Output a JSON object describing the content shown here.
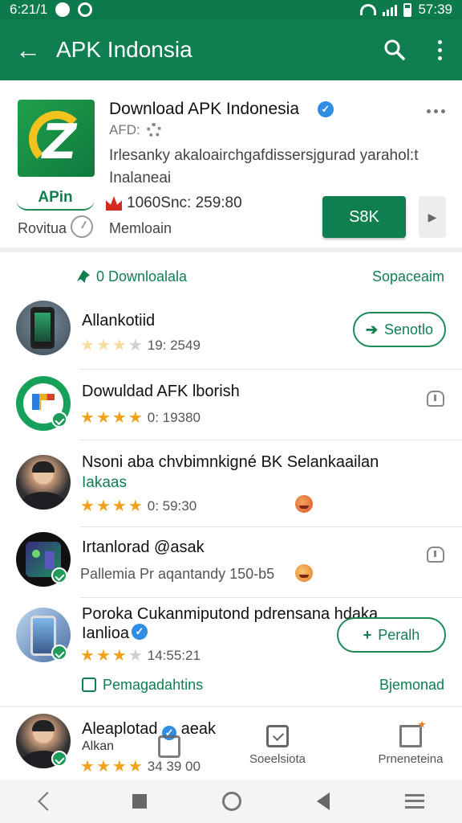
{
  "status": {
    "left_time": "6:21/1",
    "right_time": "57:39"
  },
  "appbar": {
    "title": "APK Indonsia"
  },
  "header": {
    "title": "Download APK Indonesia",
    "dev": "AFD:",
    "desc": "Irlesanky akaloairchgafdissersjgurad yarahol:t Inalaneai",
    "apk_label": "APin",
    "rovitua": "Rovitua",
    "stats": "1060Snc: 259:80",
    "memloain": "Memloain",
    "start_btn": "S8K",
    "next_icon": "chevron-right-icon"
  },
  "section1": {
    "left": "0 Downloalala",
    "right": "Sopaceaim"
  },
  "section2": {
    "left": "Pemagadahtins",
    "right": "Bjemonad"
  },
  "rows": [
    {
      "title": "Allankotiid",
      "meta": "19: 2549",
      "button": "Senotlo",
      "stars": 3
    },
    {
      "title": "Dowuldad AFK lborish",
      "meta": "0: 19380",
      "stars": 4
    },
    {
      "title": "Nsoni aba chvbimnkigné BK Selankaailan",
      "subtitle": "Iakaas",
      "meta": "0: 59:30",
      "stars": 4
    },
    {
      "title": "Irtanlorad @asak",
      "meta": "Pallemia  Pr aqantandy 150-b5"
    },
    {
      "title": "Poroka Cukanmiputond pdrensana hdaka Ianlioa",
      "meta": "14:55:21",
      "button": "Peralh",
      "stars": 3
    },
    {
      "title": "Aleaplotad",
      "title2": "aeak",
      "subtitle": "Alkan",
      "meta": "34 39 00",
      "stars": 5
    }
  ],
  "bottom_tabs": [
    {
      "label": "Soeelsiota"
    },
    {
      "label": "Prneneteina"
    }
  ],
  "nav": {
    "items": [
      "back-icon",
      "recent-icon",
      "home-icon",
      "back-triangle-icon",
      "menu-icon"
    ]
  }
}
